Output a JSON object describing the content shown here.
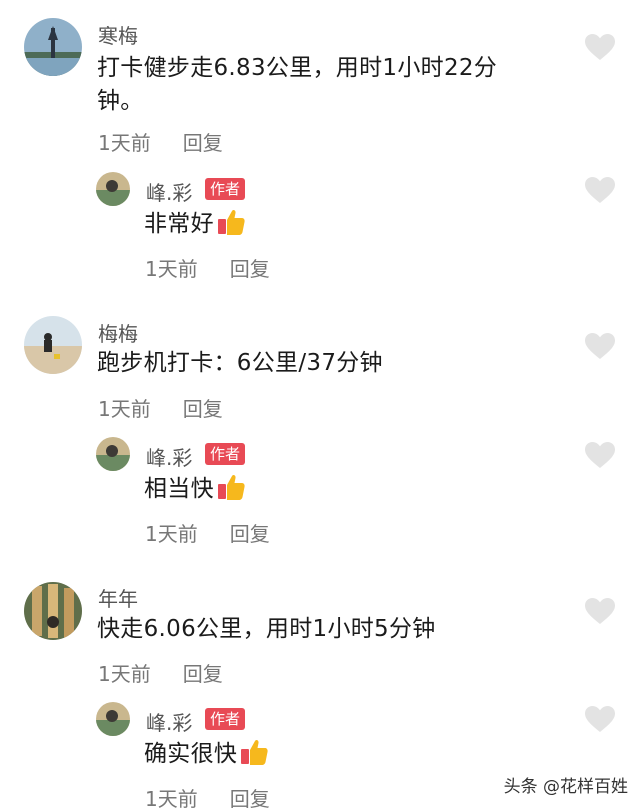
{
  "comments": [
    {
      "name": "寒梅",
      "text_line1": "打卡健步走6.83公里，用时1小时22分",
      "text_line2": "钟。",
      "time": "1天前",
      "reply_label": "回复",
      "reply": {
        "name": "峰.彩",
        "badge": "作者",
        "text": "非常好",
        "time": "1天前",
        "reply_label": "回复"
      }
    },
    {
      "name": "梅梅",
      "text_line1": "跑步机打卡：6公里/37分钟",
      "time": "1天前",
      "reply_label": "回复",
      "reply": {
        "name": "峰.彩",
        "badge": "作者",
        "text": "相当快",
        "time": "1天前",
        "reply_label": "回复"
      }
    },
    {
      "name": "年年",
      "text_line1": "快走6.06公里，用时1小时5分钟",
      "time": "1天前",
      "reply_label": "回复",
      "reply": {
        "name": "峰.彩",
        "badge": "作者",
        "text": "确实很快",
        "time": "1天前",
        "reply_label": "回复"
      }
    }
  ],
  "watermark": "头条 @花样百姓",
  "colors": {
    "badge": "#e84a55",
    "heart": "#e3e3e3"
  }
}
